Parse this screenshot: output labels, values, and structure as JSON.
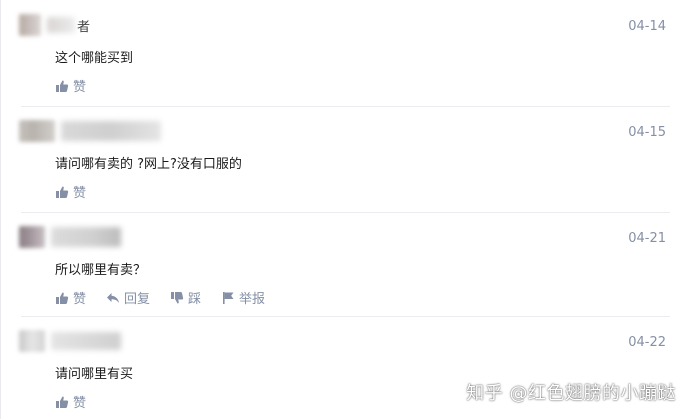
{
  "comments": [
    {
      "author_tail": "者",
      "date": "04-14",
      "text": "这个哪能买到",
      "actions": [
        {
          "icon": "thumbs-up-icon",
          "label": "赞"
        }
      ]
    },
    {
      "author_tail": "",
      "date": "04-15",
      "text": "请问哪有卖的 ?网上?没有口服的",
      "actions": [
        {
          "icon": "thumbs-up-icon",
          "label": "赞"
        }
      ]
    },
    {
      "author_tail": "",
      "date": "04-21",
      "text": "所以哪里有卖？",
      "actions": [
        {
          "icon": "thumbs-up-icon",
          "label": "赞"
        },
        {
          "icon": "reply-icon",
          "label": "回复"
        },
        {
          "icon": "thumbs-down-icon",
          "label": "踩"
        },
        {
          "icon": "flag-icon",
          "label": "举报"
        }
      ]
    },
    {
      "author_tail": "",
      "date": "04-22",
      "text": "请问哪里有买",
      "actions": [
        {
          "icon": "thumbs-up-icon",
          "label": "赞"
        }
      ]
    }
  ],
  "watermark": "知乎 @红色翅膀的小蹦跶",
  "colors": {
    "meta": "#8590a6",
    "text": "#1a1a1a",
    "divider": "#ececf0"
  }
}
